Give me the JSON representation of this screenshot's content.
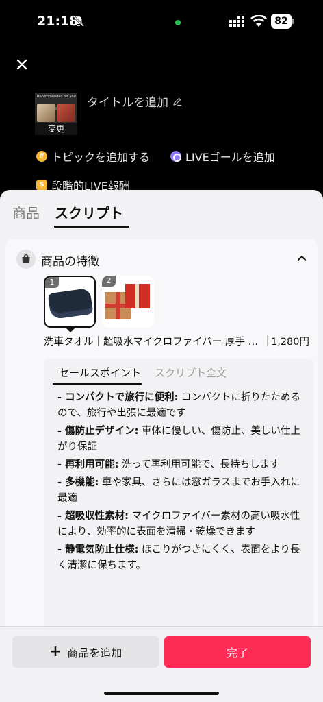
{
  "status_bar": {
    "time": "21:18",
    "battery": "82"
  },
  "header": {
    "thumbnail_caption": "Recommended for you",
    "thumbnail_change": "変更",
    "title_placeholder": "タイトルを追加",
    "add_topic": "トピックを追加する",
    "add_live_goal": "LIVEゴールを追加",
    "tiered_reward": "段階的LIVE報酬"
  },
  "tabs": {
    "products": "商品",
    "script": "スクリプト"
  },
  "feature_card": {
    "title": "商品の特徴",
    "products": [
      {
        "index": "1",
        "selected": true
      },
      {
        "index": "2",
        "selected": false
      }
    ],
    "product_name": "洗車タオル｜超吸水マイクロファイバー 厚手 柔らかい",
    "product_price": "1,280円",
    "subtabs": {
      "selling_points": "セールスポイント",
      "full_script": "スクリプト全文"
    },
    "points": [
      {
        "title": "- コンパクトで旅行に便利:",
        "text": " コンパクトに折りたためるので、旅行や出張に最適です"
      },
      {
        "title": "- 傷防止デザイン:",
        "text": " 車体に優しい、傷防止、美しい仕上がり保証"
      },
      {
        "title": "- 再利用可能:",
        "text": " 洗って再利用可能で、長持ちします"
      },
      {
        "title": "- 多機能:",
        "text": " 車や家具、さらには窓ガラスまでお手入れに最適"
      },
      {
        "title": "- 超吸収性素材:",
        "text": " マイクロファイバー素材の高い吸水性により、効率的に表面を清掃・乾燥できます"
      },
      {
        "title": "- 静電気防止仕様:",
        "text": " ほこりがつきにくく、表面をより長く清潔に保ちます。"
      }
    ]
  },
  "bottom": {
    "add_product": "商品を追加",
    "done": "完了"
  },
  "colors": {
    "accent": "#fe2c55",
    "sheet_bg": "#f2f2f4"
  }
}
